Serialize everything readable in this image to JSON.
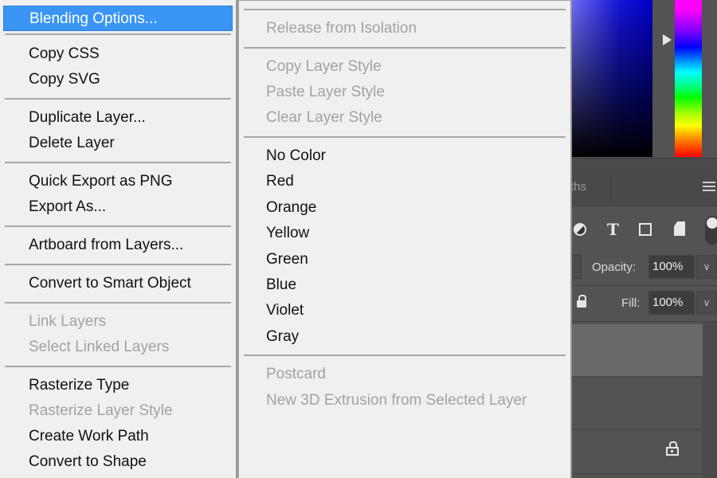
{
  "main_menu": {
    "items": [
      {
        "label": "Blending Options...",
        "enabled": true,
        "highlighted": true
      },
      {
        "label": "Copy CSS",
        "enabled": true
      },
      {
        "label": "Copy SVG",
        "enabled": true
      },
      {
        "label": "Duplicate Layer...",
        "enabled": true
      },
      {
        "label": "Delete Layer",
        "enabled": true
      },
      {
        "label": "Quick Export as PNG",
        "enabled": true
      },
      {
        "label": "Export As...",
        "enabled": true
      },
      {
        "label": "Artboard from Layers...",
        "enabled": true
      },
      {
        "label": "Convert to Smart Object",
        "enabled": true
      },
      {
        "label": "Link Layers",
        "enabled": false
      },
      {
        "label": "Select Linked Layers",
        "enabled": false
      },
      {
        "label": "Rasterize Type",
        "enabled": true
      },
      {
        "label": "Rasterize Layer Style",
        "enabled": false
      },
      {
        "label": "Create Work Path",
        "enabled": true
      },
      {
        "label": "Convert to Shape",
        "enabled": true
      }
    ]
  },
  "sub_menu": {
    "items": [
      {
        "label": "Release from Isolation",
        "enabled": false
      },
      {
        "label": "Copy Layer Style",
        "enabled": false
      },
      {
        "label": "Paste Layer Style",
        "enabled": false
      },
      {
        "label": "Clear Layer Style",
        "enabled": false
      },
      {
        "label": "No Color",
        "enabled": true
      },
      {
        "label": "Red",
        "enabled": true
      },
      {
        "label": "Orange",
        "enabled": true
      },
      {
        "label": "Yellow",
        "enabled": true
      },
      {
        "label": "Green",
        "enabled": true
      },
      {
        "label": "Blue",
        "enabled": true
      },
      {
        "label": "Violet",
        "enabled": true
      },
      {
        "label": "Gray",
        "enabled": true
      },
      {
        "label": "Postcard",
        "enabled": false
      },
      {
        "label": "New 3D Extrusion from Selected Layer",
        "enabled": false
      }
    ]
  },
  "layers_panel": {
    "tab_label": "ths",
    "opacity_label": "Opacity:",
    "opacity_value": "100%",
    "fill_label": "Fill:",
    "fill_value": "100%",
    "dropdown_glyph": "∨"
  },
  "colors": {
    "highlight": "#3a95f5",
    "menu_bg": "#f0f0f0",
    "panel_bg": "#535353"
  }
}
